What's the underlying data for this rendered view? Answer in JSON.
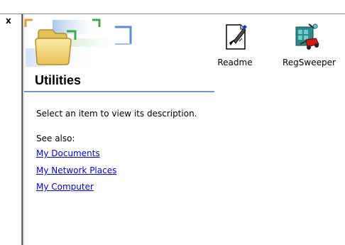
{
  "close_glyph": "x",
  "folder": {
    "title": "Utilities",
    "description": "Select an item to view its description.",
    "see_also_label": "See also:",
    "links": [
      "My Documents",
      "My Network Places",
      "My Computer"
    ]
  },
  "files": [
    {
      "name": "Readme",
      "icon": "text-file-icon"
    },
    {
      "name": "RegSweeper",
      "icon": "regsweeper-app-icon"
    }
  ],
  "colors": {
    "title_rule": "#7195c9",
    "link": "#0000ee",
    "folder_yellow": "#f3d978"
  }
}
